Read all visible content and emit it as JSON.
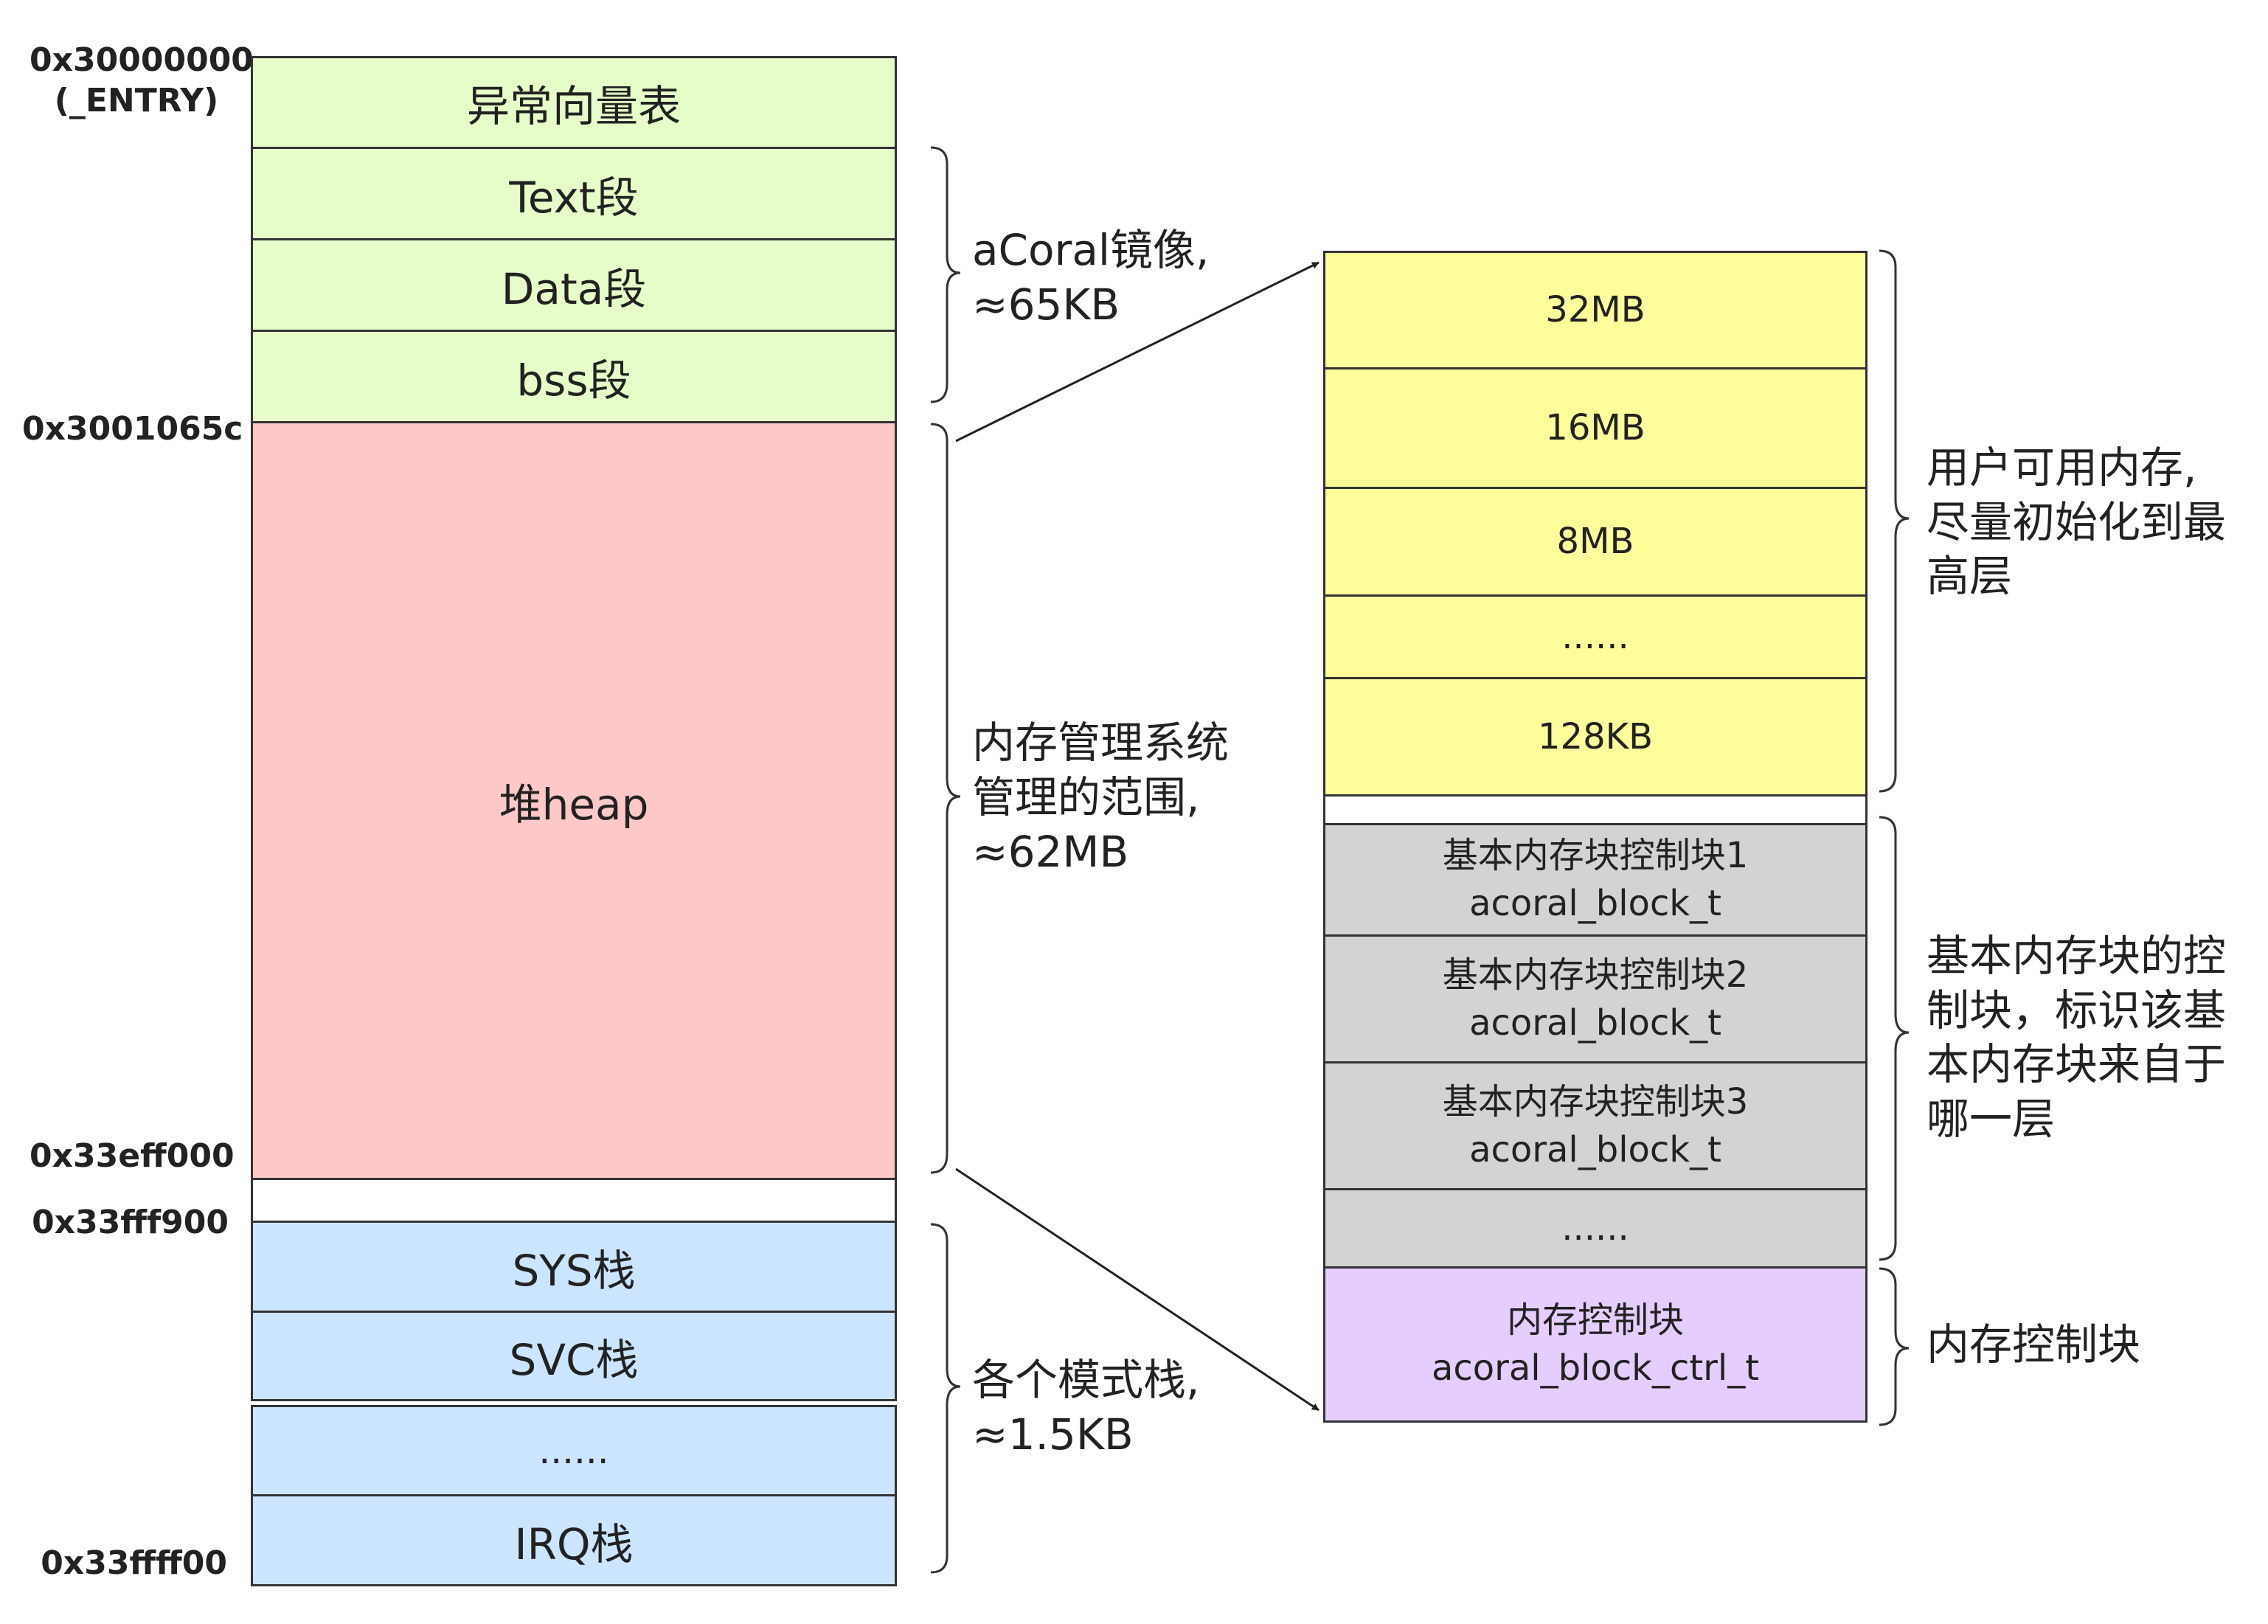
{
  "addresses": {
    "entry_line1": "0x30000000",
    "entry_line2": "(_ENTRY)",
    "bss_end": "0x3001065c",
    "heap_end": "0x33eff000",
    "stack_start": "0x33fff900",
    "stack_end": "0x33ffff00"
  },
  "left_column": {
    "vector_table": "异常向量表",
    "text": "Text段",
    "data": "Data段",
    "bss": "bss段",
    "heap": "堆heap",
    "sys_stack": "SYS栈",
    "svc_stack": "SVC栈",
    "stack_ellipsis": "......",
    "irq_stack": "IRQ栈"
  },
  "annotations": {
    "image_line1": "aCoral镜像,",
    "image_line2": "≈65KB",
    "heap_line1": "内存管理系统",
    "heap_line2": "管理的范围,",
    "heap_line3": "≈62MB",
    "stack_line1": "各个模式栈,",
    "stack_line2": "≈1.5KB"
  },
  "right_column": {
    "levels": [
      "32MB",
      "16MB",
      "8MB",
      "......",
      "128KB"
    ],
    "block_ctrl": [
      {
        "name": "基本内存块控制块1",
        "type": "acoral_block_t"
      },
      {
        "name": "基本内存块控制块2",
        "type": "acoral_block_t"
      },
      {
        "name": "基本内存块控制块3",
        "type": "acoral_block_t"
      }
    ],
    "block_ctrl_ellipsis": "......",
    "mem_ctrl_name": "内存控制块",
    "mem_ctrl_type": "acoral_block_ctrl_t"
  },
  "right_notes": {
    "user_line1": "用户可用内存,",
    "user_line2": "尽量初始化到最",
    "user_line3": "高层",
    "block_line1": "基本内存块的控",
    "block_line2": "制块，标识该基",
    "block_line3": "本内存块来自于",
    "block_line4": "哪一层",
    "ctrl_note": "内存控制块"
  },
  "colors": {
    "code_sections": "#e6fcc9",
    "heap": "#fdc9c8",
    "stacks": "#cce5fe",
    "user_memory": "#fdfd9b",
    "block_control": "#d3d3d3",
    "memory_control": "#e5cdfe"
  }
}
